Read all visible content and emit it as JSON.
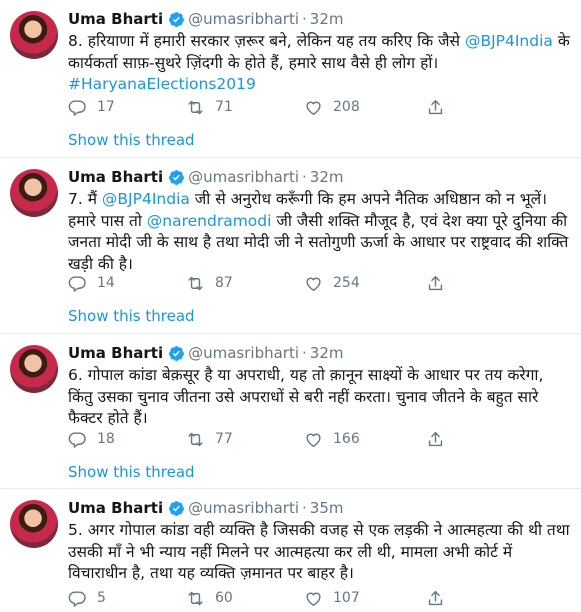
{
  "tweets": [
    {
      "name": "Uma Bharti",
      "handle": "@umasribharti",
      "dot": "·",
      "time": "32m",
      "segments": [
        {
          "t": "8. हरियाणा में हमारी सरकार ज़रूर बने, लेकिन यह तय करिए कि जैसे ",
          "link": false
        },
        {
          "t": "@BJP4India",
          "link": true
        },
        {
          "t": " के कार्यकर्ता साफ़-सुथरे ज़िंदगी के होते हैं, हमारे साथ वैसे ही लोग हों। ",
          "link": false
        },
        {
          "t": "#HaryanaElections2019",
          "link": true
        }
      ],
      "replies": "17",
      "retweets": "71",
      "likes": "208",
      "show_thread": "Show this thread"
    },
    {
      "name": "Uma Bharti",
      "handle": "@umasribharti",
      "dot": "·",
      "time": "32m",
      "segments": [
        {
          "t": "7. मैं ",
          "link": false
        },
        {
          "t": "@BJP4India",
          "link": true
        },
        {
          "t": " जी से अनुरोध करूँगी कि हम अपने नैतिक अधिष्ठान को न भूलें। हमारे पास तो ",
          "link": false
        },
        {
          "t": "@narendramodi",
          "link": true
        },
        {
          "t": " जी जैसी शक्ति मौजूद है, एवं देश क्या पूरे दुनिया की जनता मोदी जी के साथ है तथा मोदी जी ने सतोगुणी ऊर्जा के आधार पर राष्ट्रवाद की शक्ति खड़ी की है।",
          "link": false
        }
      ],
      "replies": "14",
      "retweets": "87",
      "likes": "254",
      "show_thread": "Show this thread"
    },
    {
      "name": "Uma Bharti",
      "handle": "@umasribharti",
      "dot": "·",
      "time": "32m",
      "segments": [
        {
          "t": "6. गोपाल कांडा बेक़सूर है या अपराधी, यह तो क़ानून साक्ष्यों के आधार पर तय करेगा, किंतु उसका चुनाव जीतना उसे अपराधों से बरी नहीं करता। चुनाव जीतने के बहुत सारे फैक्टर होते हैं।",
          "link": false
        }
      ],
      "replies": "18",
      "retweets": "77",
      "likes": "166",
      "show_thread": "Show this thread"
    },
    {
      "name": "Uma Bharti",
      "handle": "@umasribharti",
      "dot": "·",
      "time": "35m",
      "segments": [
        {
          "t": "5. अगर गोपाल कांडा वही व्यक्ति है जिसकी वजह से एक लड़की ने आत्महत्या की थी तथा उसकी माँ ने भी न्याय नहीं मिलने पर आत्महत्या कर ली थी, मामला अभी कोर्ट में विचाराधीन है, तथा यह व्यक्ति ज़मानत पर बाहर है।",
          "link": false
        }
      ],
      "replies": "5",
      "retweets": "60",
      "likes": "107",
      "show_thread": ""
    }
  ],
  "icons": {
    "reply": "reply-icon",
    "retweet": "retweet-icon",
    "like": "heart-icon",
    "share": "share-icon",
    "verified": "verified-badge-icon"
  },
  "colors": {
    "link": "#1b95e0",
    "muted": "#657786",
    "text": "#14171a",
    "divider": "#e6ecf0"
  }
}
